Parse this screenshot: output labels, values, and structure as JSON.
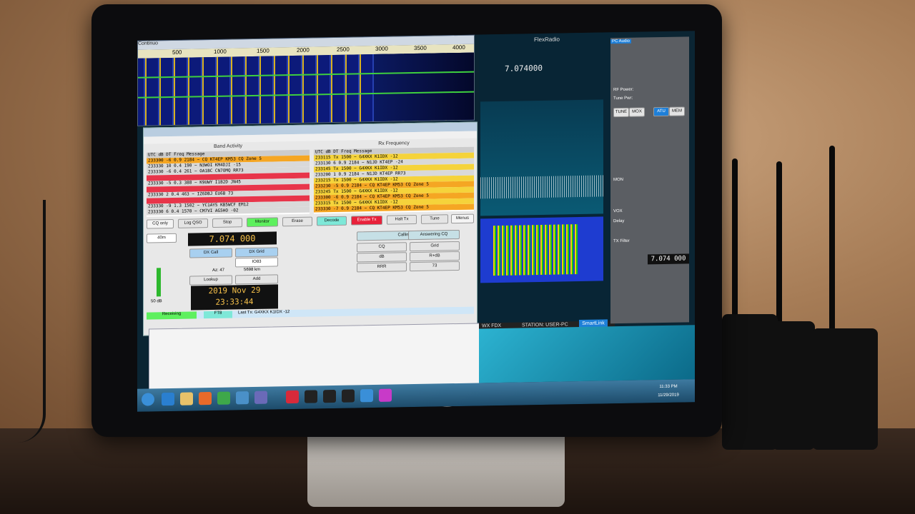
{
  "scene": {
    "flexradio_label": "FlexRadio",
    "hp_logo": "hp",
    "pc_audio": "PC Audio",
    "rf_power": "RF Power:",
    "tune_pwr": "Tune Pwr:",
    "tune": "TUNE",
    "mox": "MOX",
    "atu": "ATU",
    "mem": "MEM",
    "mon": "MON",
    "vox": "VOX",
    "delay": "Delay",
    "tx_filter": "TX Filter",
    "station": "STATION: USER-PC",
    "smartlink": "SmartLink",
    "flex_freq": "7.074000",
    "side_freq": "7.074 000",
    "wx_fdx": "WX  FDX"
  },
  "waterfall": {
    "title": "Continuo",
    "scale": [
      "500",
      "1000",
      "1500",
      "2000",
      "2500",
      "3000",
      "3500",
      "4000"
    ]
  },
  "wsjt": {
    "band_activity": "Band Activity",
    "rx_frequency": "Rx Frequency",
    "columns": "UTC  dB  DT Freq     Message",
    "left_rows": [
      {
        "t": "233300  -6  0.9 2184 ~  CQ KT4EP KM53     CQ Zone 5",
        "c": "r-orange"
      },
      {
        "t": "233330  10  0.4  190 ~  N3WOI KM4DJI -15",
        "c": "r-gray"
      },
      {
        "t": "233330  -6  0.4  261 ~  OA1BC CN7OMQ RR73",
        "c": "r-gray"
      },
      {
        "t": "",
        "c": "r-red"
      },
      {
        "t": "233330  -5  0.3  388 ~  K9UWY I1B2D JN45",
        "c": "r-gray"
      },
      {
        "t": "",
        "c": "r-red"
      },
      {
        "t": "233330   2  0.4  463 ~  IZ6DBJ EU6B 73",
        "c": "r-gray"
      },
      {
        "t": "",
        "c": "r-red"
      },
      {
        "t": "233330  -9  1.3 1502 ~  YC1AYS KB5WCF EM12",
        "c": "r-gray"
      },
      {
        "t": "233330   6  0.4 1570 ~  CM7VI AG5HO -02",
        "c": "r-gray"
      }
    ],
    "right_rows": [
      {
        "t": "233115  Tx      1500 ~  G4XKX K1IDX -12",
        "c": "r-yellow"
      },
      {
        "t": "233130   6  0.9 2184 ~  N1JD KT4EP -24",
        "c": "r-gray"
      },
      {
        "t": "233145  Tx      1500 ~  G4XKX K1IDX -12",
        "c": "r-yellow"
      },
      {
        "t": "233200   1  0.9 2184 ~  N1JD KT4EP RR73",
        "c": "r-gray"
      },
      {
        "t": "233215  Tx      1500 ~  G4XKX K1IDX -12",
        "c": "r-yellow"
      },
      {
        "t": "233230  -5  0.9 2184 ~  CQ KT4EP KM53     CQ Zone 5",
        "c": "r-orange"
      },
      {
        "t": "233245  Tx      1500 ~  G4XKX K1IDX -12",
        "c": "r-yellow"
      },
      {
        "t": "233300  -6  0.9 2184 ~  CQ KT4EP KM53     CQ Zone 5",
        "c": "r-orange"
      },
      {
        "t": "233315  Tx      1500 ~  G4XKX K1IDX -12",
        "c": "r-yellow"
      },
      {
        "t": "233330  -7  0.9 2184 ~  CQ KT4EP KM53     CQ Zone 5",
        "c": "r-orange"
      }
    ],
    "buttons": {
      "cq_only": "CQ only",
      "log_qso": "Log QSO",
      "stop": "Stop",
      "monitor": "Monitor",
      "erase": "Erase",
      "decode": "Decode",
      "enable_tx": "Enable Tx",
      "halt_tx": "Halt Tx",
      "tune": "Tune",
      "menus": "Menus",
      "dx_call": "DX Call",
      "dx_grid": "DX Grid",
      "lookup": "Lookup",
      "add": "Add",
      "calling_cq": "Calling CQ",
      "answering_cq": "Answering CQ",
      "cq": "CQ",
      "grid": "Grid",
      "db": "dB",
      "r_db": "R+dB",
      "rrr": "RRR",
      "73": "73"
    },
    "band": "40m",
    "frequency": "7.074 000",
    "date": "2019 Nov 29",
    "time": "23:33:44",
    "status_receiving": "Receiving",
    "status_ft8": "FT8",
    "status_last_tx": "Last Tx: G4XKX K1IDX -12",
    "level_db": "50 dB",
    "dx_grid_value": "IO83",
    "az": "Az: 47",
    "distance": "5698 km"
  },
  "taskbar": {
    "clock_time": "11:33 PM",
    "clock_date": "11/29/2019"
  }
}
